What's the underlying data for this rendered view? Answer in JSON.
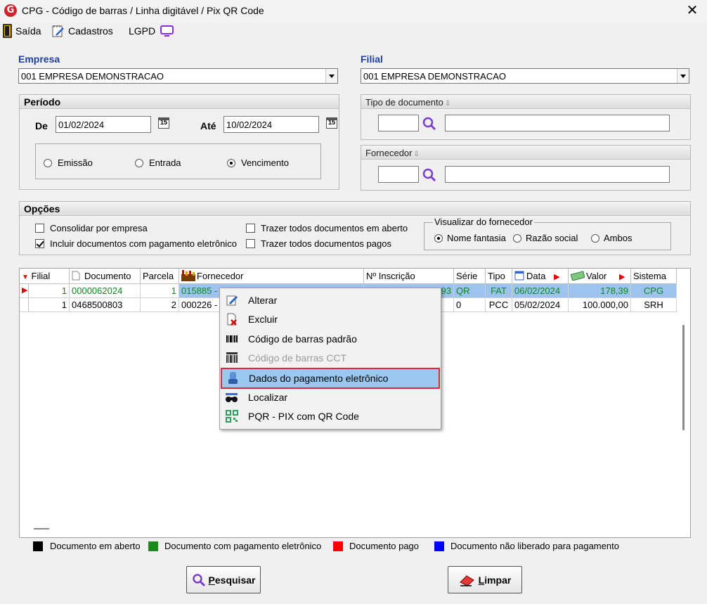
{
  "window": {
    "title": "CPG - Código de barras / Linha digitável / Pix QR Code",
    "close": "✕",
    "logo": "G"
  },
  "toolbar": {
    "saida": "Saída",
    "cadastros": "Cadastros",
    "lgpd": "LGPD"
  },
  "empresa": {
    "label": "Empresa",
    "value": "001 EMPRESA DEMONSTRACAO"
  },
  "filial": {
    "label": "Filial",
    "value": "001 EMPRESA DEMONSTRACAO"
  },
  "periodo": {
    "title": "Período",
    "de_label": "De",
    "de_value": "01/02/2024",
    "ate_label": "Até",
    "ate_value": "10/02/2024",
    "cal_glyph": "15",
    "radios": [
      "Emissão",
      "Entrada",
      "Vencimento"
    ],
    "selected": "Vencimento"
  },
  "tipo_documento": {
    "title": "Tipo de documento",
    "code": "",
    "desc": ""
  },
  "fornecedor_filter": {
    "title": "Fornecedor",
    "code": "",
    "desc": ""
  },
  "opcoes": {
    "title": "Opções",
    "consolidar": "Consolidar por empresa",
    "incluir": "Incluir documentos com pagamento eletrônico",
    "trazer_abertos": "Trazer todos documentos em aberto",
    "trazer_pagos": "Trazer todos documentos pagos",
    "visualizar": {
      "title": "Visualizar do fornecedor",
      "options": [
        "Nome fantasia",
        "Razão social",
        "Ambos"
      ],
      "selected": "Nome fantasia"
    }
  },
  "grid": {
    "columns": [
      "Filial",
      "Documento",
      "Parcela",
      "Fornecedor",
      "Nº Inscrição",
      "Série",
      "Tipo",
      "Data",
      "Valor",
      "Sistema"
    ],
    "rows": [
      {
        "filial": "1",
        "documento": "0000062024",
        "parcela": "1",
        "fornecedor": "015885 -",
        "inscricao": "93",
        "serie": "QR",
        "tipo": "FAT",
        "data": "06/02/2024",
        "valor": "178,39",
        "sistema": "CPG"
      },
      {
        "filial": "1",
        "documento": "0468500803",
        "parcela": "2",
        "fornecedor": "000226 -",
        "inscricao": "",
        "serie": "0",
        "tipo": "PCC",
        "data": "05/02/2024",
        "valor": "100.000,00",
        "sistema": "SRH"
      }
    ]
  },
  "context_menu": [
    {
      "label": "Alterar",
      "icon": "edit-icon",
      "disabled": false,
      "highlighted": false
    },
    {
      "label": "Excluir",
      "icon": "delete-icon",
      "disabled": false,
      "highlighted": false
    },
    {
      "label": "Código de barras padrão",
      "icon": "barcode-icon",
      "disabled": false,
      "highlighted": false
    },
    {
      "label": "Código de barras CCT",
      "icon": "barcode-cct-icon",
      "disabled": true,
      "highlighted": false
    },
    {
      "label": "Dados do pagamento eletrônico",
      "icon": "electronic-payment-icon",
      "disabled": false,
      "highlighted": true
    },
    {
      "label": "Localizar",
      "icon": "binoculars-icon",
      "disabled": false,
      "highlighted": false
    },
    {
      "label": "PQR - PIX com QR Code",
      "icon": "qr-code-icon",
      "disabled": false,
      "highlighted": false
    }
  ],
  "legend": [
    {
      "label": "Documento em aberto",
      "color": "#000000"
    },
    {
      "label": "Documento com pagamento eletrônico",
      "color": "#1a8c1a"
    },
    {
      "label": "Documento pago",
      "color": "#ff0000"
    },
    {
      "label": "Documento não liberado para pagamento",
      "color": "#0000ff"
    }
  ],
  "buttons": {
    "pesquisar_hotkey": "P",
    "pesquisar_rest": "esquisar",
    "limpar_hotkey": "L",
    "limpar_rest": "impar"
  }
}
